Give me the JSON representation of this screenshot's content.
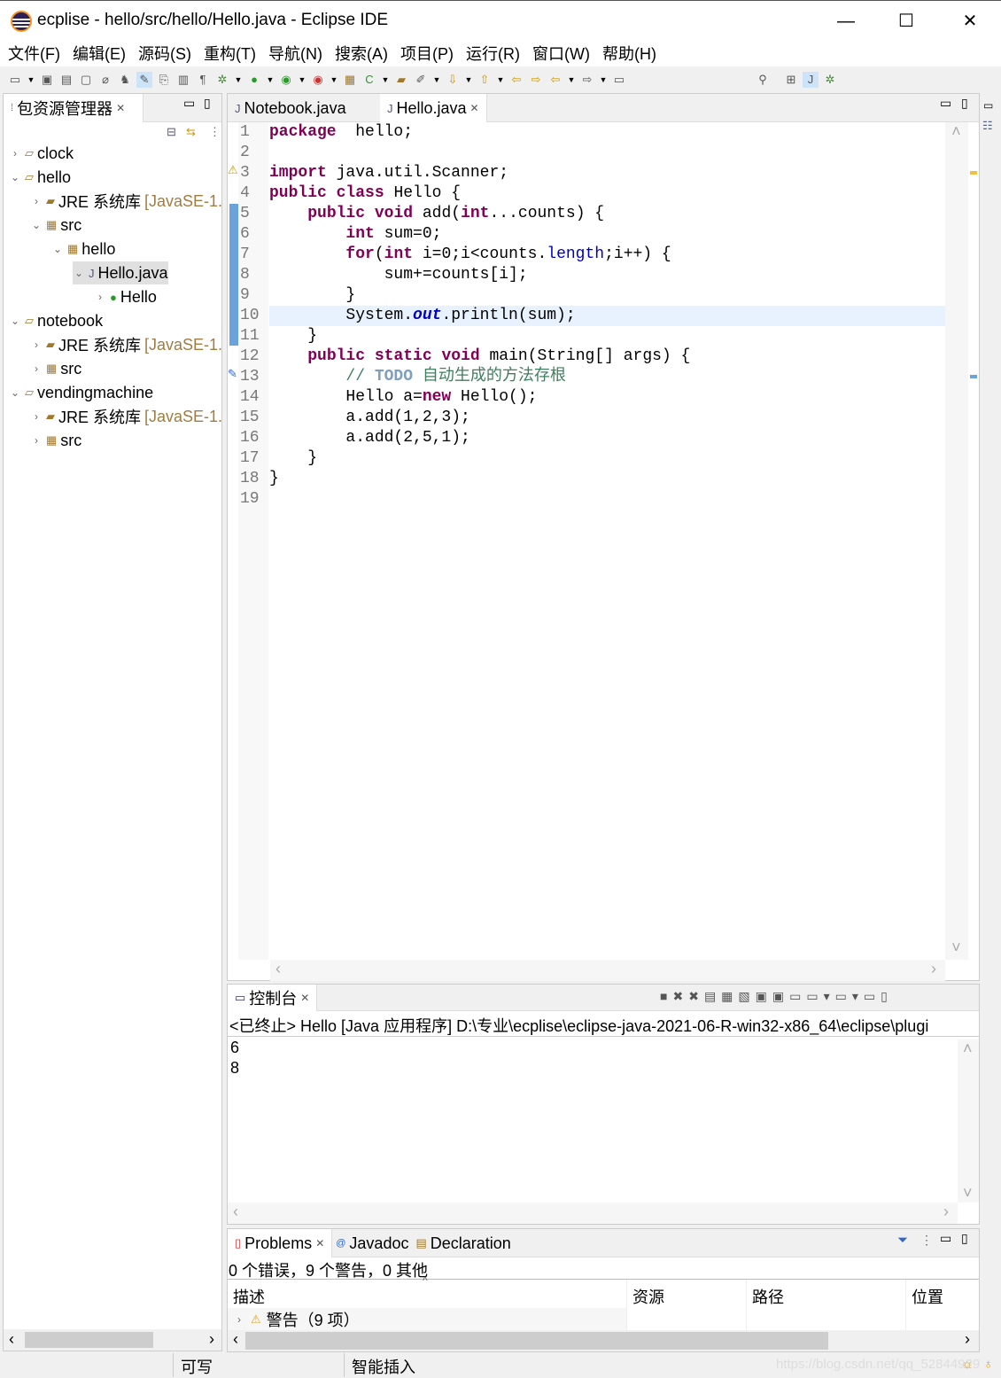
{
  "window": {
    "title": "ecplise - hello/src/hello/Hello.java - Eclipse IDE",
    "minimize": "—",
    "maximize": "☐",
    "close": "✕"
  },
  "menu": [
    "文件(F)",
    "编辑(E)",
    "源码(S)",
    "重构(T)",
    "导航(N)",
    "搜索(A)",
    "项目(P)",
    "运行(R)",
    "窗口(W)",
    "帮助(H)"
  ],
  "explorer": {
    "title": "包资源管理器",
    "tree": [
      {
        "label": "clock",
        "depth": 0,
        "tw": "›",
        "icon": "project-icon"
      },
      {
        "label": "hello",
        "depth": 0,
        "tw": "⌄",
        "icon": "project-icon"
      },
      {
        "label": "JRE 系统库",
        "suffix": " [JavaSE-1.",
        "depth": 1,
        "tw": "›",
        "icon": "library-icon"
      },
      {
        "label": "src",
        "depth": 1,
        "tw": "⌄",
        "icon": "source-folder-icon"
      },
      {
        "label": "hello",
        "depth": 2,
        "tw": "⌄",
        "icon": "package-icon"
      },
      {
        "label": "Hello.java",
        "depth": 3,
        "tw": "⌄",
        "icon": "java-file-icon",
        "selected": true
      },
      {
        "label": "Hello",
        "depth": 4,
        "tw": "›",
        "icon": "class-icon"
      },
      {
        "label": "notebook",
        "depth": 0,
        "tw": "⌄",
        "icon": "project-icon"
      },
      {
        "label": "JRE 系统库",
        "suffix": " [JavaSE-1.",
        "depth": 1,
        "tw": "›",
        "icon": "library-icon"
      },
      {
        "label": "src",
        "depth": 1,
        "tw": "›",
        "icon": "source-folder-icon"
      },
      {
        "label": "vendingmachine",
        "depth": 0,
        "tw": "⌄",
        "icon": "project-icon"
      },
      {
        "label": "JRE 系统库",
        "suffix": " [JavaSE-1.",
        "depth": 1,
        "tw": "›",
        "icon": "library-icon"
      },
      {
        "label": "src",
        "depth": 1,
        "tw": "›",
        "icon": "source-folder-icon"
      }
    ]
  },
  "editor": {
    "tabs": [
      {
        "label": "Notebook.java",
        "active": false
      },
      {
        "label": "Hello.java",
        "active": true
      }
    ],
    "current_line": 10,
    "lines": [
      [
        [
          "kw",
          "package"
        ],
        [
          "",
          "  hello;"
        ]
      ],
      [],
      [
        [
          "kw",
          "import"
        ],
        [
          "",
          " java.util.Scanner;"
        ]
      ],
      [
        [
          "kw",
          "public"
        ],
        [
          "",
          " "
        ],
        [
          "kw",
          "class"
        ],
        [
          "",
          " Hello {"
        ]
      ],
      [
        [
          "",
          "    "
        ],
        [
          "kw",
          "public"
        ],
        [
          "",
          " "
        ],
        [
          "kw",
          "void"
        ],
        [
          "",
          " add("
        ],
        [
          "kw",
          "int"
        ],
        [
          "",
          "...counts) {"
        ]
      ],
      [
        [
          "",
          "        "
        ],
        [
          "kw",
          "int"
        ],
        [
          "",
          " sum=0;"
        ]
      ],
      [
        [
          "",
          "        "
        ],
        [
          "kw",
          "for"
        ],
        [
          "",
          "("
        ],
        [
          "kw",
          "int"
        ],
        [
          "",
          " i=0;i<counts."
        ],
        [
          "fld",
          "length"
        ],
        [
          "",
          ";i++) {"
        ]
      ],
      [
        [
          "",
          "            sum+=counts[i];"
        ]
      ],
      [
        [
          "",
          "        }"
        ]
      ],
      [
        [
          "",
          "        System."
        ],
        [
          "sfld",
          "out"
        ],
        [
          "",
          ".println(sum);"
        ]
      ],
      [
        [
          "",
          "    }"
        ]
      ],
      [
        [
          "",
          "    "
        ],
        [
          "kw",
          "public"
        ],
        [
          "",
          " "
        ],
        [
          "kw",
          "static"
        ],
        [
          "",
          " "
        ],
        [
          "kw",
          "void"
        ],
        [
          "",
          " main(String[] args) {"
        ]
      ],
      [
        [
          "",
          "        "
        ],
        [
          "cm",
          "// "
        ],
        [
          "todo",
          "TODO"
        ],
        [
          "cm",
          " 自动生成的方法存根"
        ]
      ],
      [
        [
          "",
          "        Hello a="
        ],
        [
          "kw",
          "new"
        ],
        [
          "",
          " Hello();"
        ]
      ],
      [
        [
          "",
          "        a.add(1,2,3);"
        ]
      ],
      [
        [
          "",
          "        a.add(2,5,1);"
        ]
      ],
      [
        [
          "",
          "    }"
        ]
      ],
      [
        [
          "",
          "}"
        ]
      ],
      []
    ]
  },
  "console": {
    "title": "控制台",
    "status": "<已终止> Hello [Java 应用程序] D:\\专业\\ecplise\\eclipse-java-2021-06-R-win32-x86_64\\eclipse\\plugi",
    "output": [
      "6",
      "8"
    ]
  },
  "problems": {
    "tabs": [
      "Problems",
      "Javadoc",
      "Declaration"
    ],
    "summary": "0 个错误，9 个警告，0 其他",
    "columns": [
      "描述",
      "资源",
      "路径",
      "位置"
    ],
    "rows": [
      {
        "label": "警告（9 项）"
      }
    ]
  },
  "status": {
    "writable": "可写",
    "insert_mode": "智能插入",
    "watermark": "https://blog.csdn.net/qq_52844929"
  }
}
